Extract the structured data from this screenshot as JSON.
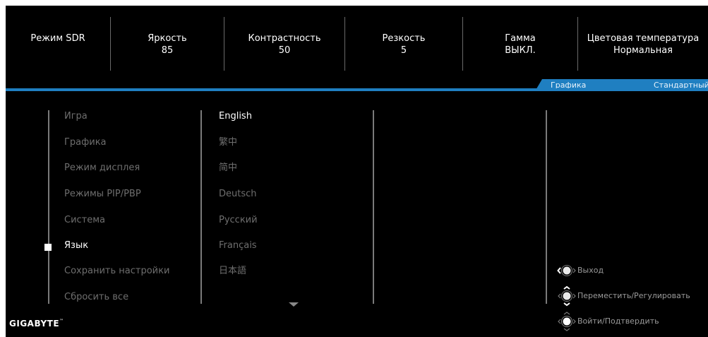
{
  "status_bar": [
    {
      "label": "Режим SDR",
      "value": ""
    },
    {
      "label": "Яркость",
      "value": "85"
    },
    {
      "label": "Контрастность",
      "value": "50"
    },
    {
      "label": "Резкость",
      "value": "5"
    },
    {
      "label": "Гамма",
      "value": "ВЫКЛ."
    },
    {
      "label": "Цветовая температура",
      "value": "Нормальная"
    }
  ],
  "header_tab": {
    "left": "Графика",
    "right": "Стандартный"
  },
  "menu": [
    {
      "label": "Игра"
    },
    {
      "label": "Графика"
    },
    {
      "label": "Режим дисплея"
    },
    {
      "label": "Режимы PIP/PBP"
    },
    {
      "label": "Система"
    },
    {
      "label": "Язык"
    },
    {
      "label": "Сохранить настройки"
    },
    {
      "label": "Сбросить все"
    }
  ],
  "selected_menu_index": 5,
  "languages": [
    {
      "label": "English"
    },
    {
      "label": "繁中"
    },
    {
      "label": "简中"
    },
    {
      "label": "Deutsch"
    },
    {
      "label": "Русский"
    },
    {
      "label": "Français"
    },
    {
      "label": "日本語"
    }
  ],
  "selected_language_index": 0,
  "hints": [
    {
      "icon": "joystick-left-icon",
      "label": "Выход"
    },
    {
      "icon": "joystick-updown-icon",
      "label": "Переместить/Регулировать"
    },
    {
      "icon": "joystick-press-icon",
      "label": "Войти/Подтвердить"
    }
  ],
  "brand": {
    "name": "GIGABYTE",
    "tm": "™"
  },
  "colors": {
    "accent": "#1f7fc1",
    "background": "#000000",
    "inactive_text": "#6e6e6e",
    "active_text": "#ffffff"
  }
}
